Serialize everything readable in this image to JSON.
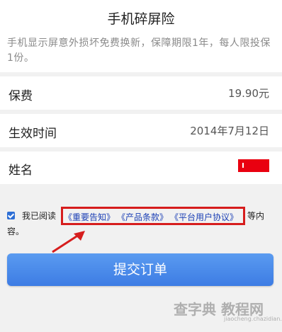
{
  "header": {
    "title": "手机碎屏险",
    "description": "手机显示屏意外损坏免费换新，保障期限1年，每人限投保1份。"
  },
  "rows": [
    {
      "label": "保费",
      "value": "19.90元"
    },
    {
      "label": "生效时间",
      "value": "2014年7月12日"
    },
    {
      "label": "姓名"
    }
  ],
  "agreement": {
    "checked": true,
    "prefix": "我已阅读",
    "links": [
      "《重要告知》",
      "《产品条款》",
      "《平台用户协议》"
    ],
    "suffix_line1": "等内",
    "suffix_line2": "容。"
  },
  "submit_label": "提交订单",
  "watermark": {
    "brand": "查字典 教程网",
    "url": "jiaocheng.chazidian.com"
  },
  "colors": {
    "button": "#3d7ce4",
    "link": "#1b3fb5",
    "highlight": "#d61d1d",
    "redact": "#e90010"
  }
}
